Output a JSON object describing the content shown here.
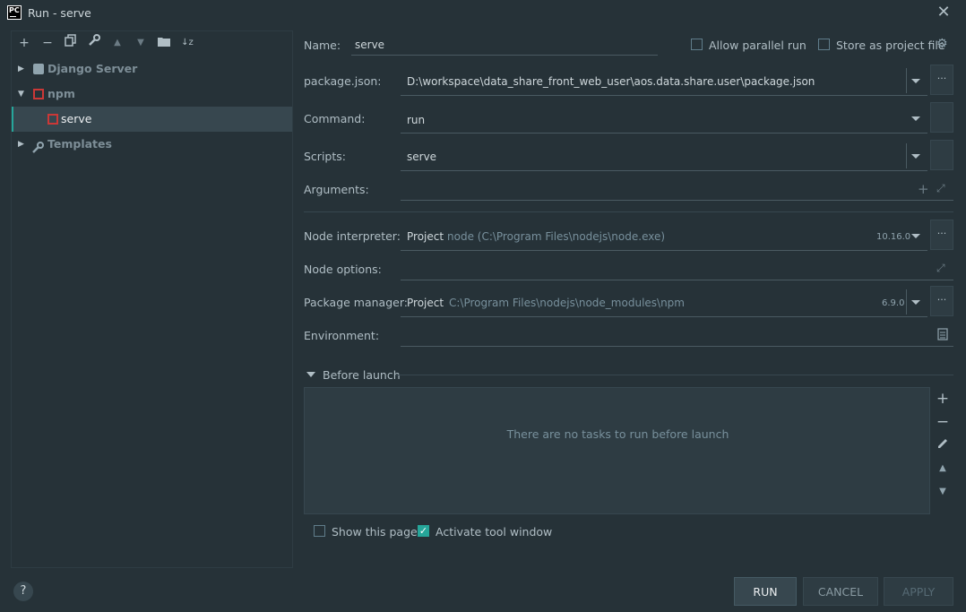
{
  "window": {
    "title": "Run - serve",
    "app_icon_text": "PC"
  },
  "toolbar": {
    "icons": [
      "add-icon",
      "remove-icon",
      "copy-icon",
      "wrench-icon",
      "move-up-icon",
      "move-down-icon",
      "folder-icon",
      "sort-icon"
    ],
    "add_glyph": "+",
    "remove_glyph": "−",
    "copy_glyph": "⧉",
    "wrench_glyph": "🔧",
    "up_glyph": "▲",
    "down_glyph": "▼",
    "folder_glyph": "▰",
    "sort_glyph": "↓z"
  },
  "tree": {
    "django_label": "Django Server",
    "npm_label": "npm",
    "serve_label": "serve",
    "templates_label": "Templates"
  },
  "form": {
    "name_label": "Name:",
    "name_value": "serve",
    "allow_parallel_label": "Allow parallel run",
    "allow_parallel_checked": false,
    "store_project_label": "Store as project file",
    "store_project_checked": false,
    "package_json_label": "package.json:",
    "package_json_value": "D:\\workspace\\data_share_front_web_user\\aos.data.share.user\\package.json",
    "command_label": "Command:",
    "command_value": "run",
    "scripts_label": "Scripts:",
    "scripts_value": "serve",
    "arguments_label": "Arguments:",
    "arguments_value": "",
    "node_interpreter_label": "Node interpreter:",
    "node_interpreter_prefix": "Project",
    "node_interpreter_path": "node (C:\\Program Files\\nodejs\\node.exe)",
    "node_interpreter_version": "10.16.0",
    "node_options_label": "Node options:",
    "node_options_value": "",
    "package_manager_label": "Package manager:",
    "package_manager_prefix": "Project",
    "package_manager_path": "C:\\Program Files\\nodejs\\node_modules\\npm",
    "package_manager_version": "6.9.0",
    "environment_label": "Environment:",
    "environment_value": "",
    "ellipsis": "..."
  },
  "before_launch": {
    "title": "Before launch",
    "empty_text": "There are no tasks to run before launch",
    "show_page_label": "Show this page",
    "show_page_checked": false,
    "activate_tool_label": "Activate tool window",
    "activate_tool_checked": true
  },
  "buttons": {
    "run": "RUN",
    "cancel": "CANCEL",
    "apply": "APPLY",
    "help": "?"
  },
  "colors": {
    "background": "#263238",
    "panel": "#2e3c43",
    "accent": "#26a69a",
    "selection": "#37474f"
  }
}
